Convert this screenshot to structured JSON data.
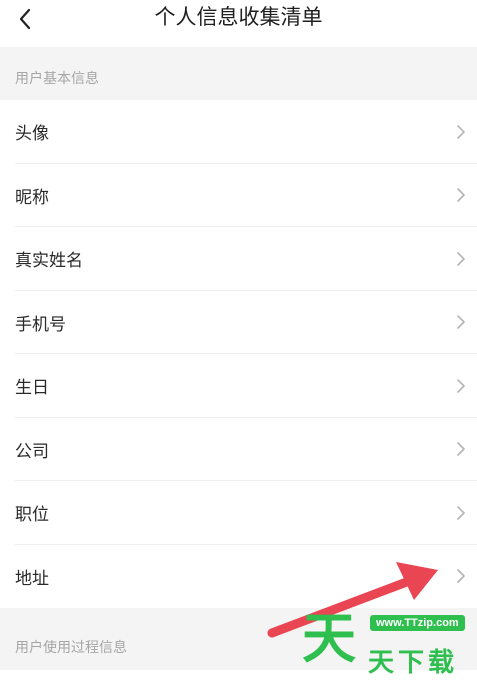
{
  "header": {
    "title": "个人信息收集清单",
    "back_icon": "chevron-left-icon"
  },
  "sections": {
    "basic": {
      "label": "用户基本信息",
      "items": [
        {
          "label": "头像"
        },
        {
          "label": "昵称"
        },
        {
          "label": "真实姓名"
        },
        {
          "label": "手机号"
        },
        {
          "label": "生日"
        },
        {
          "label": "公司"
        },
        {
          "label": "职位"
        },
        {
          "label": "地址"
        }
      ]
    },
    "usage": {
      "label": "用户使用过程信息"
    }
  },
  "watermark": {
    "url": "www.TTzip.com",
    "logo_char": "天",
    "text": "天下载"
  },
  "colors": {
    "accent_arrow": "#e94552",
    "watermark_green": "#2fbf4f",
    "section_text": "#a6a6a6",
    "background": "#f4f4f4"
  }
}
